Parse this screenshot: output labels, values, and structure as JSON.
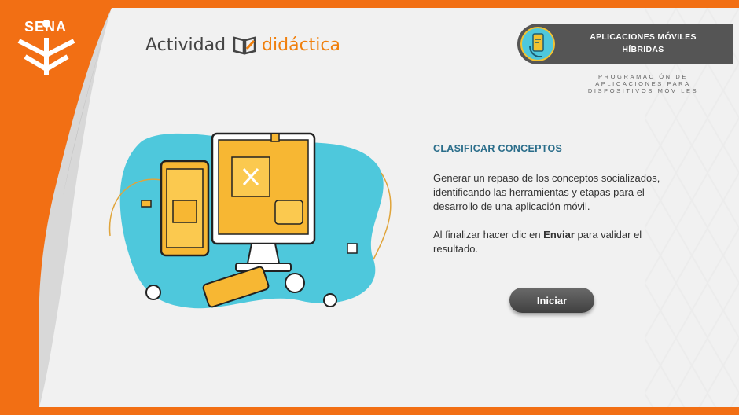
{
  "brand": {
    "logo_text": "SENA"
  },
  "header": {
    "activity_word": "Actividad",
    "didactic_word": "didáctica"
  },
  "module": {
    "icon": "mobile-hand-icon",
    "name_line1": "APLICACIONES MÓVILES",
    "name_line2": "HÍBRIDAS",
    "program_line1": "PROGRAMACIÓN DE",
    "program_line2": "APLICACIONES PARA",
    "program_line3": "DISPOSITIVOS MÓVILES"
  },
  "activity": {
    "title": "CLASIFICAR CONCEPTOS",
    "description": "Generar un repaso de los conceptos socializados, identificando las herramientas y etapas para el desarrollo de una aplicación móvil.",
    "instruction_prefix": "Al finalizar hacer clic en ",
    "instruction_bold": "Enviar",
    "instruction_suffix": " para validar el resultado.",
    "start_button": "Iniciar"
  },
  "colors": {
    "orange": "#f26f14",
    "panel": "#f1f1f1",
    "title_blue": "#2a6d8a",
    "illustration_blue": "#4ec8dc",
    "illustration_yellow": "#f7b733"
  }
}
